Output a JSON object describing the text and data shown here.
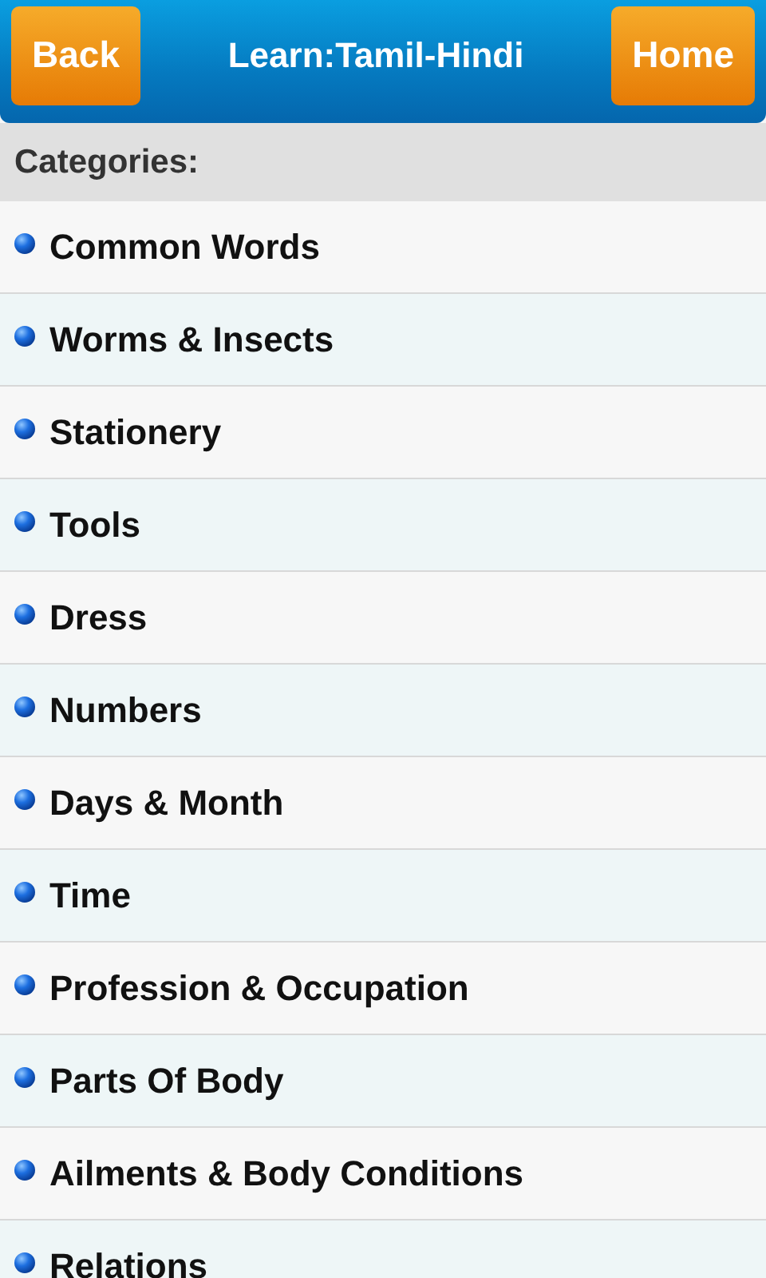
{
  "header": {
    "back": "Back",
    "title": "Learn:Tamil-Hindi",
    "home": "Home"
  },
  "section_title": "Categories:",
  "categories": [
    "Common Words",
    "Worms & Insects",
    "Stationery",
    "Tools",
    "Dress",
    "Numbers",
    "Days & Month",
    "Time",
    "Profession & Occupation",
    "Parts Of Body",
    "Ailments & Body Conditions",
    "Relations"
  ]
}
